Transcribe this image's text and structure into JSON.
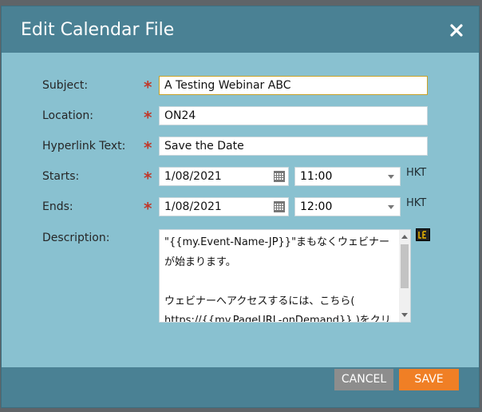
{
  "dialog": {
    "title": "Edit Calendar File",
    "close_icon": "close-icon"
  },
  "form": {
    "subject": {
      "label": "Subject:",
      "value": "A Testing Webinar ABC"
    },
    "location": {
      "label": "Location:",
      "value": "ON24"
    },
    "hyperlink": {
      "label": "Hyperlink Text:",
      "value": "Save the Date"
    },
    "starts": {
      "label": "Starts:",
      "date": "1/08/2021",
      "time": "11:00",
      "tz": "HKT"
    },
    "ends": {
      "label": "Ends:",
      "date": "1/08/2021",
      "time": "12:00",
      "tz": "HKT"
    },
    "description": {
      "label": "Description:",
      "lines": [
        "\"{{my.Event-Name-JP}}\"まもなくウェビナー",
        "が始まります。",
        "",
        "ウェビナーへアクセスするには、こちら(",
        "https://{{my.PageURL-onDemand}} )をクリ"
      ]
    },
    "required_mark": "*"
  },
  "footer": {
    "cancel_label": "CANCEL",
    "save_label": "SAVE"
  },
  "colors": {
    "titlebar": "#4a8194",
    "body": "#89c1d0",
    "save": "#f07f25",
    "cancel": "#8d8d8d"
  }
}
